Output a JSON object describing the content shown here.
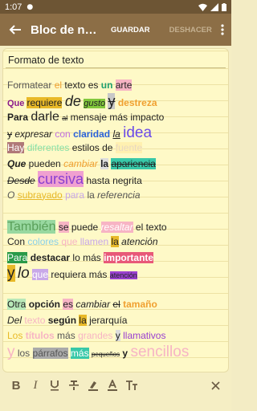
{
  "status": {
    "time": "1:07"
  },
  "toolbar": {
    "title": "Bloc de no...",
    "save_label": "GUARDAR",
    "undo_label": "DESHACER"
  },
  "note": {
    "subject": "Formato de texto",
    "lines": [
      [
        [
          "Formatear",
          "underline;color:#555"
        ],
        [
          " el ",
          "color:#f0a030"
        ],
        [
          "texto es ",
          ""
        ],
        [
          "un",
          "color:#20a070;font-weight:bold"
        ],
        [
          " ",
          ""
        ],
        [
          "arte",
          "background:#f7b4c4"
        ]
      ],
      [
        [
          "Que ",
          "color:#8a1a8a;font-weight:bold;font-size:11px"
        ],
        [
          "requiere",
          "background:#e8b928;color:#222"
        ],
        [
          " ",
          ""
        ],
        [
          "de",
          "font-size:18px;font-style:italic"
        ],
        [
          " ",
          ""
        ],
        [
          "gusto",
          "background:#82c83c;font-style:italic;font-size:11px"
        ],
        [
          " ",
          ""
        ],
        [
          "y",
          "background:#c8c8c8;font-size:18px;text-decoration:line-through"
        ],
        [
          " ",
          ""
        ],
        [
          "destreza",
          "color:#f0a030;font-weight:bold"
        ]
      ],
      [
        [
          "Para ",
          "font-weight:bold"
        ],
        [
          "darle",
          "font-size:16px"
        ],
        [
          " ",
          ""
        ],
        [
          "al",
          "font-size:9px;text-decoration:line-through"
        ],
        [
          " mensaje más impacto",
          ""
        ]
      ],
      [
        [
          "y",
          "text-decoration:line-through"
        ],
        [
          " ",
          ""
        ],
        [
          "expresar",
          "font-style:italic"
        ],
        [
          " ",
          ""
        ],
        [
          "con",
          "color:#c070e0"
        ],
        [
          " ",
          ""
        ],
        [
          "claridad",
          "color:#2a62d8;font-weight:bold"
        ],
        [
          " ",
          ""
        ],
        [
          "la",
          "font-style:italic;text-decoration:underline"
        ],
        [
          " ",
          ""
        ],
        [
          "idea",
          "color:#6a4ae8;font-size:19px"
        ]
      ],
      [
        [
          "Hay",
          "background:#b07878;color:#fff"
        ],
        [
          " ",
          ""
        ],
        [
          "diferentes",
          "color:#88e0a8"
        ],
        [
          " estilos de ",
          ""
        ],
        [
          "fuente",
          "color:#e8d8c0;background:#fff0b0"
        ]
      ],
      [
        [
          "Que",
          "font-weight:bold;font-style:italic"
        ],
        [
          " pueden ",
          ""
        ],
        [
          "cambiar",
          "color:#f0a030;font-style:italic"
        ],
        [
          " ",
          ""
        ],
        [
          "la",
          "background:#ddd;font-weight:bold"
        ],
        [
          " ",
          ""
        ],
        [
          "apariencia",
          "background:#38c8a8;text-decoration:line-through"
        ]
      ],
      [
        [
          "Desde",
          "font-style:italic;text-decoration:line-through"
        ],
        [
          " ",
          ""
        ],
        [
          "cursiva",
          "background:#f0a0d0;color:#8a40d0;font-size:18px"
        ],
        [
          " hasta negrita",
          ""
        ]
      ],
      [
        [
          "O",
          "color:#555;font-style:italic"
        ],
        [
          " ",
          ""
        ],
        [
          "subrayado",
          "color:#e8b928;text-decoration:underline"
        ],
        [
          " ",
          ""
        ],
        [
          "para",
          "color:#c8a8e8"
        ],
        [
          " la ",
          "color:#555"
        ],
        [
          "referencia",
          "color:#555;font-style:italic"
        ]
      ],
      [
        [
          "",
          ""
        ]
      ],
      [
        [
          "También",
          "background:#98d8a0;color:#5aa05a;font-size:16px"
        ],
        [
          " ",
          ""
        ],
        [
          "se",
          "background:#f7b4c4"
        ],
        [
          " puede ",
          ""
        ],
        [
          "resaltar",
          "background:#f7b4c4;color:#fff;font-style:italic"
        ],
        [
          " el texto",
          ""
        ]
      ],
      [
        [
          "Con",
          "color:#222"
        ],
        [
          " ",
          ""
        ],
        [
          "colores",
          "color:#8ad0e8"
        ],
        [
          " ",
          ""
        ],
        [
          "que",
          "color:#f7b4c4"
        ],
        [
          " ",
          ""
        ],
        [
          "llamen",
          "color:#c8a8e8"
        ],
        [
          " ",
          ""
        ],
        [
          "la",
          "background:#e8b928"
        ],
        [
          " ",
          ""
        ],
        [
          "atención",
          "font-style:italic"
        ]
      ],
      [
        [
          "Para",
          "background:#2a9a48;color:#fff"
        ],
        [
          " ",
          ""
        ],
        [
          "destacar",
          "font-weight:bold"
        ],
        [
          " lo más ",
          ""
        ],
        [
          "importante",
          "background:#e85878;color:#fff;font-weight:bold"
        ]
      ],
      [
        [
          "y",
          "background:#e8b928;font-size:19px"
        ],
        [
          " ",
          ""
        ],
        [
          "lo",
          "font-size:19px;font-style:italic"
        ],
        [
          " ",
          ""
        ],
        [
          "que",
          "background:#c8a8e8;color:#fff"
        ],
        [
          " requiera más ",
          ""
        ],
        [
          "atención",
          "background:#9a40d0;color:#222;font-size:9px"
        ]
      ],
      [
        [
          "",
          ""
        ]
      ],
      [
        [
          "Otra",
          "background:#b8e8b8"
        ],
        [
          " ",
          ""
        ],
        [
          "opción",
          "font-weight:bold"
        ],
        [
          " ",
          ""
        ],
        [
          "es",
          "background:#f7b4c4"
        ],
        [
          " ",
          ""
        ],
        [
          "cambiar",
          "font-style:italic"
        ],
        [
          " ",
          ""
        ],
        [
          "el",
          "text-decoration:line-through"
        ],
        [
          " ",
          ""
        ],
        [
          "tamaño",
          "color:#f0a030;font-weight:bold"
        ]
      ],
      [
        [
          "Del",
          "font-style:italic"
        ],
        [
          " ",
          ""
        ],
        [
          "texto",
          "color:#f7b4c4"
        ],
        [
          " ",
          ""
        ],
        [
          "según",
          "font-weight:bold"
        ],
        [
          " ",
          ""
        ],
        [
          "la",
          "background:#e8b928"
        ],
        [
          " jerarquía",
          ""
        ]
      ],
      [
        [
          "Los",
          "color:#e8b928"
        ],
        [
          " ",
          ""
        ],
        [
          "títulos",
          "color:#f7b4c4;font-weight:bold"
        ],
        [
          " ",
          ""
        ],
        [
          "más",
          "color:#555"
        ],
        [
          " ",
          ""
        ],
        [
          "grandes",
          "color:#f7b4c4"
        ],
        [
          " ",
          ""
        ],
        [
          "y",
          "background:#ddd"
        ],
        [
          " ",
          ""
        ],
        [
          "llamativos",
          "color:#9a40d0"
        ]
      ],
      [
        [
          "y",
          "color:#f7b4c4;font-size:19px"
        ],
        [
          " ",
          ""
        ],
        [
          "los",
          "color:#555"
        ],
        [
          " ",
          ""
        ],
        [
          "párrafos",
          "background:#aaa;color:#555"
        ],
        [
          " ",
          ""
        ],
        [
          "más",
          "background:#38c8a8;color:#fff"
        ],
        [
          " ",
          ""
        ],
        [
          "pequeños",
          "font-size:8px;text-decoration:line-through"
        ],
        [
          " ",
          ""
        ],
        [
          "y",
          "font-weight:bold"
        ],
        [
          " ",
          ""
        ],
        [
          "sencillos",
          "color:#f7b4c4;font-size:19px"
        ]
      ]
    ]
  },
  "format_bar": {
    "bold": "B",
    "italic": "I"
  }
}
